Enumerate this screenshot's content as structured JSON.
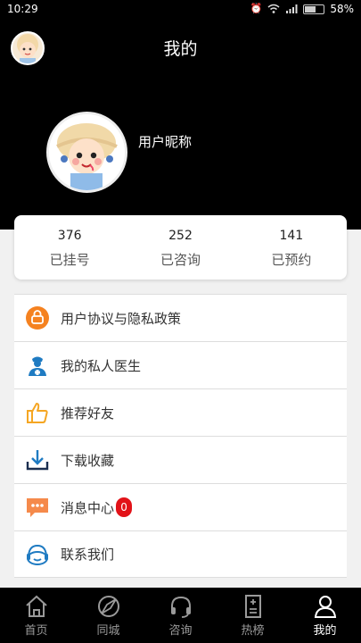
{
  "status": {
    "time": "10:29",
    "battery": "58%",
    "battery_level": 0.58
  },
  "header": {
    "title": "我的",
    "nickname": "用户昵称"
  },
  "stats": [
    {
      "value": "376",
      "label": "已挂号"
    },
    {
      "value": "252",
      "label": "已咨询"
    },
    {
      "value": "141",
      "label": "已预约"
    }
  ],
  "menu": [
    {
      "label": "用户协议与隐私政策",
      "icon": "agreement-icon"
    },
    {
      "label": "我的私人医生",
      "icon": "doctor-icon"
    },
    {
      "label": "推荐好友",
      "icon": "thumbs-up-icon"
    },
    {
      "label": "下载收藏",
      "icon": "download-icon"
    },
    {
      "label": "消息中心",
      "icon": "message-icon",
      "badge": "0"
    },
    {
      "label": "联系我们",
      "icon": "headset-icon"
    }
  ],
  "tabs": [
    {
      "label": "首页",
      "icon": "home-icon"
    },
    {
      "label": "同城",
      "icon": "compass-icon"
    },
    {
      "label": "咨询",
      "icon": "headphones-icon"
    },
    {
      "label": "热榜",
      "icon": "list-icon"
    },
    {
      "label": "我的",
      "icon": "user-icon",
      "active": true
    }
  ],
  "colors": {
    "orange": "#f58220",
    "blue": "#1f7bc2",
    "badge": "#e21218"
  }
}
